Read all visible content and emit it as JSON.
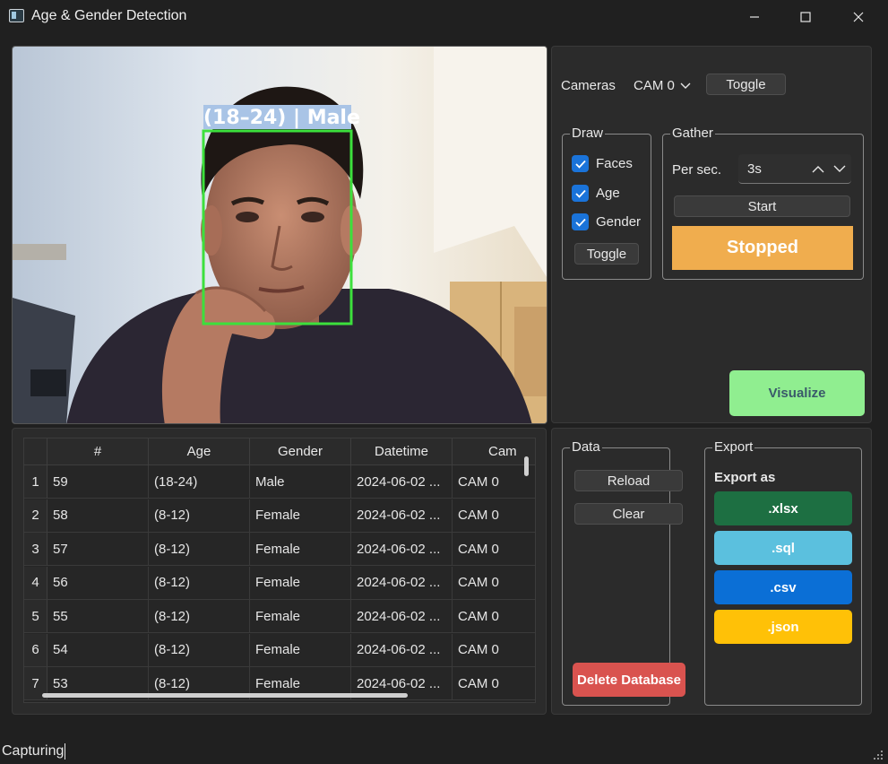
{
  "window": {
    "title": "Age & Gender Detection"
  },
  "camera_feed": {
    "overlay_label": "(18–24) | Male"
  },
  "controls": {
    "cameras_label": "Cameras",
    "camera_selected": "CAM 0",
    "camera_toggle_label": "Toggle"
  },
  "draw": {
    "title": "Draw",
    "options": [
      {
        "label": "Faces",
        "checked": true
      },
      {
        "label": "Age",
        "checked": true
      },
      {
        "label": "Gender",
        "checked": true
      }
    ],
    "toggle_label": "Toggle"
  },
  "gather": {
    "title": "Gather",
    "per_sec_label": "Per sec.",
    "per_sec_value": "3s",
    "start_label": "Start",
    "status_label": "Stopped"
  },
  "visualize_label": "Visualize",
  "table": {
    "columns": [
      "#",
      "Age",
      "Gender",
      "Datetime",
      "Cam"
    ],
    "rows": [
      {
        "n": "1",
        "cells": [
          "59",
          "(18-24)",
          "Male",
          "2024-06-02 ...",
          "CAM 0"
        ]
      },
      {
        "n": "2",
        "cells": [
          "58",
          "(8-12)",
          "Female",
          "2024-06-02 ...",
          "CAM 0"
        ]
      },
      {
        "n": "3",
        "cells": [
          "57",
          "(8-12)",
          "Female",
          "2024-06-02 ...",
          "CAM 0"
        ]
      },
      {
        "n": "4",
        "cells": [
          "56",
          "(8-12)",
          "Female",
          "2024-06-02 ...",
          "CAM 0"
        ]
      },
      {
        "n": "5",
        "cells": [
          "55",
          "(8-12)",
          "Female",
          "2024-06-02 ...",
          "CAM 0"
        ]
      },
      {
        "n": "6",
        "cells": [
          "54",
          "(8-12)",
          "Female",
          "2024-06-02 ...",
          "CAM 0"
        ]
      },
      {
        "n": "7",
        "cells": [
          "53",
          "(8-12)",
          "Female",
          "2024-06-02 ...",
          "CAM 0"
        ]
      }
    ]
  },
  "data_group": {
    "title": "Data",
    "reload_label": "Reload",
    "clear_label": "Clear",
    "delete_label": "Delete Database"
  },
  "export_group": {
    "title": "Export",
    "export_as_label": "Export as",
    "buttons": [
      {
        "label": ".xlsx",
        "color": "#1d6f42"
      },
      {
        "label": ".sql",
        "color": "#5bc0de"
      },
      {
        "label": ".csv",
        "color": "#0b6fd6"
      },
      {
        "label": ".json",
        "color": "#ffc107"
      }
    ]
  },
  "colors": {
    "stopped": "#f0ad4e",
    "visualize": "#90ee90",
    "delete": "#d9534f",
    "checkbox": "#1a73d9"
  },
  "status_bar": {
    "text": "Capturing"
  }
}
